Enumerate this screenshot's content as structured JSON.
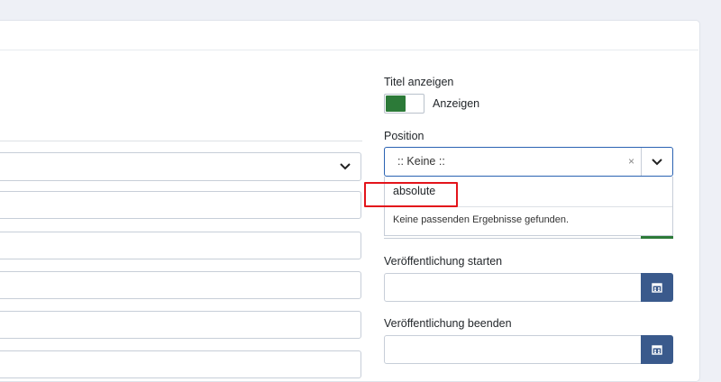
{
  "right": {
    "title_label": "Titel anzeigen",
    "toggle_label": "Anzeigen",
    "position_label": "Position",
    "position_value": ":: Keine ::",
    "position_clear": "×",
    "dropdown": {
      "typed_value": "absolute",
      "no_results": "Keine passenden Ergebnisse gefunden."
    },
    "publish_start_label": "Veröffentlichung starten",
    "publish_end_label": "Veröffentlichung beenden"
  },
  "colors": {
    "toggle_on": "#2c7a38",
    "calendar_button": "#3a5a8c",
    "focus_border": "#2a62b2",
    "highlight": "#e3141b"
  },
  "icons": {
    "select_chevron": "chevron-down-icon",
    "calendar": "calendar-icon"
  }
}
